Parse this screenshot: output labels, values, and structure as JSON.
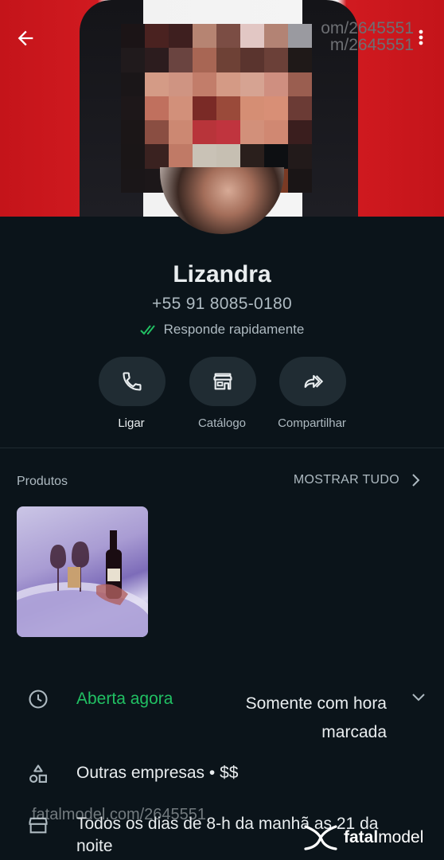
{
  "header": {
    "overlay_lines": [
      "om/2645551",
      "m/2645551"
    ],
    "back_icon": "arrow-left-icon",
    "menu_icon": "more-vertical-icon"
  },
  "profile": {
    "name": "Lizandra",
    "phone": "+55 91 8085-0180",
    "status": "Responde rapidamente",
    "status_color": "#21c063"
  },
  "actions": [
    {
      "label": "Ligar",
      "icon": "phone-icon"
    },
    {
      "label": "Catálogo",
      "icon": "storefront-icon"
    },
    {
      "label": "Compartilhar",
      "icon": "share-forward-icon"
    }
  ],
  "products": {
    "title": "Produtos",
    "show_all": "MOSTRAR TUDO"
  },
  "details": {
    "open_status": "Aberta agora",
    "hours_note": "Somente com hora marcada",
    "category": "Outras empresas • $$",
    "schedule": "Todos os dias de 8-h da manhã as 21 da noite"
  },
  "watermark": {
    "url": "fatalmodel.com/2645551",
    "brand_bold": "fatal",
    "brand_rest": "model"
  }
}
